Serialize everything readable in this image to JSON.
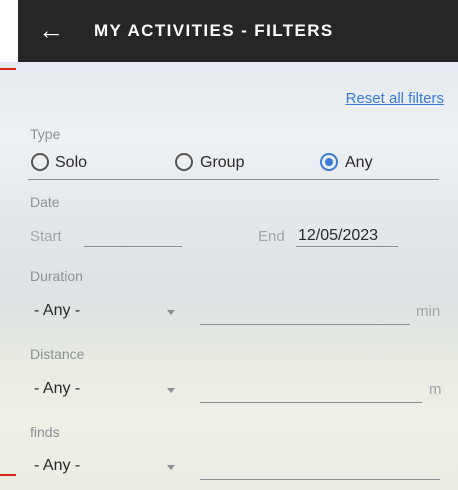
{
  "header": {
    "title": "MY ACTIVITIES - FILTERS",
    "back_icon": "arrow-left-icon"
  },
  "reset_label": "Reset all filters",
  "type": {
    "label": "Type",
    "options": [
      "Solo",
      "Group",
      "Any"
    ],
    "selected": "Any",
    "accent": "#3a7bd5"
  },
  "date": {
    "label": "Date",
    "start_label": "Start",
    "start_value": "",
    "end_label": "End",
    "end_value": "12/05/2023"
  },
  "duration": {
    "label": "Duration",
    "select_value": "- Any -",
    "input_value": "",
    "unit": "min"
  },
  "distance": {
    "label": "Distance",
    "select_value": "- Any -",
    "input_value": "",
    "unit": "m"
  },
  "finds": {
    "label": "finds",
    "select_value": "- Any -",
    "input_value": ""
  }
}
